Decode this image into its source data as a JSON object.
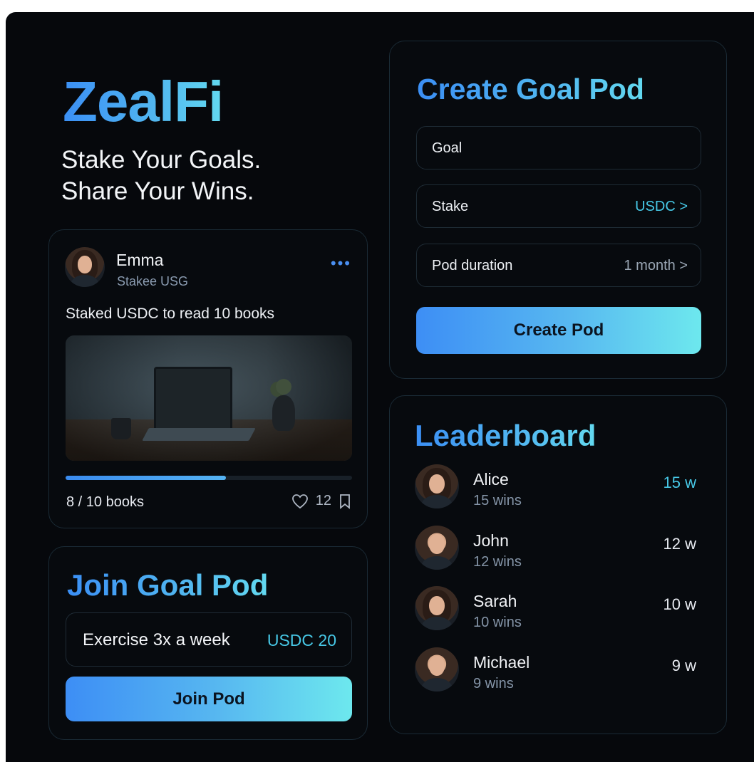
{
  "brand": {
    "name": "ZealFi",
    "tagline_line1": "Stake Your Goals.",
    "tagline_line2": "Share Your Wins."
  },
  "post": {
    "user_name": "Emma",
    "user_role": "Stakee USG",
    "more_icon": "more-dots-icon",
    "caption": "Staked USDC to read 10 books",
    "progress_text": "8 / 10 books",
    "progress_fraction": 0.56,
    "likes": "12",
    "like_icon": "heart-icon",
    "bookmark_icon": "bookmark-icon"
  },
  "join_pod": {
    "title": "Join Goal Pod",
    "goal": "Exercise 3x a week",
    "stake": "USDC 20",
    "button_label": "Join Pod"
  },
  "create_pod": {
    "title": "Create Goal Pod",
    "goal_label": "Goal",
    "stake_label": "Stake",
    "stake_value": "USDC >",
    "duration_label": "Pod duration",
    "duration_value": "1 month >",
    "button_label": "Create Pod"
  },
  "leaderboard": {
    "title": "Leaderboard",
    "entries": [
      {
        "name": "Alice",
        "wins": "15 wins",
        "score": "15 w"
      },
      {
        "name": "John",
        "wins": "12 wins",
        "score": "12 w"
      },
      {
        "name": "Sarah",
        "wins": "10 wins",
        "score": "10 w"
      },
      {
        "name": "Michael",
        "wins": "9 wins",
        "score": "9 w"
      }
    ]
  },
  "colors": {
    "accent": "#47c8e6",
    "brand_blue": "#3b8ff5",
    "background": "#06080c"
  }
}
